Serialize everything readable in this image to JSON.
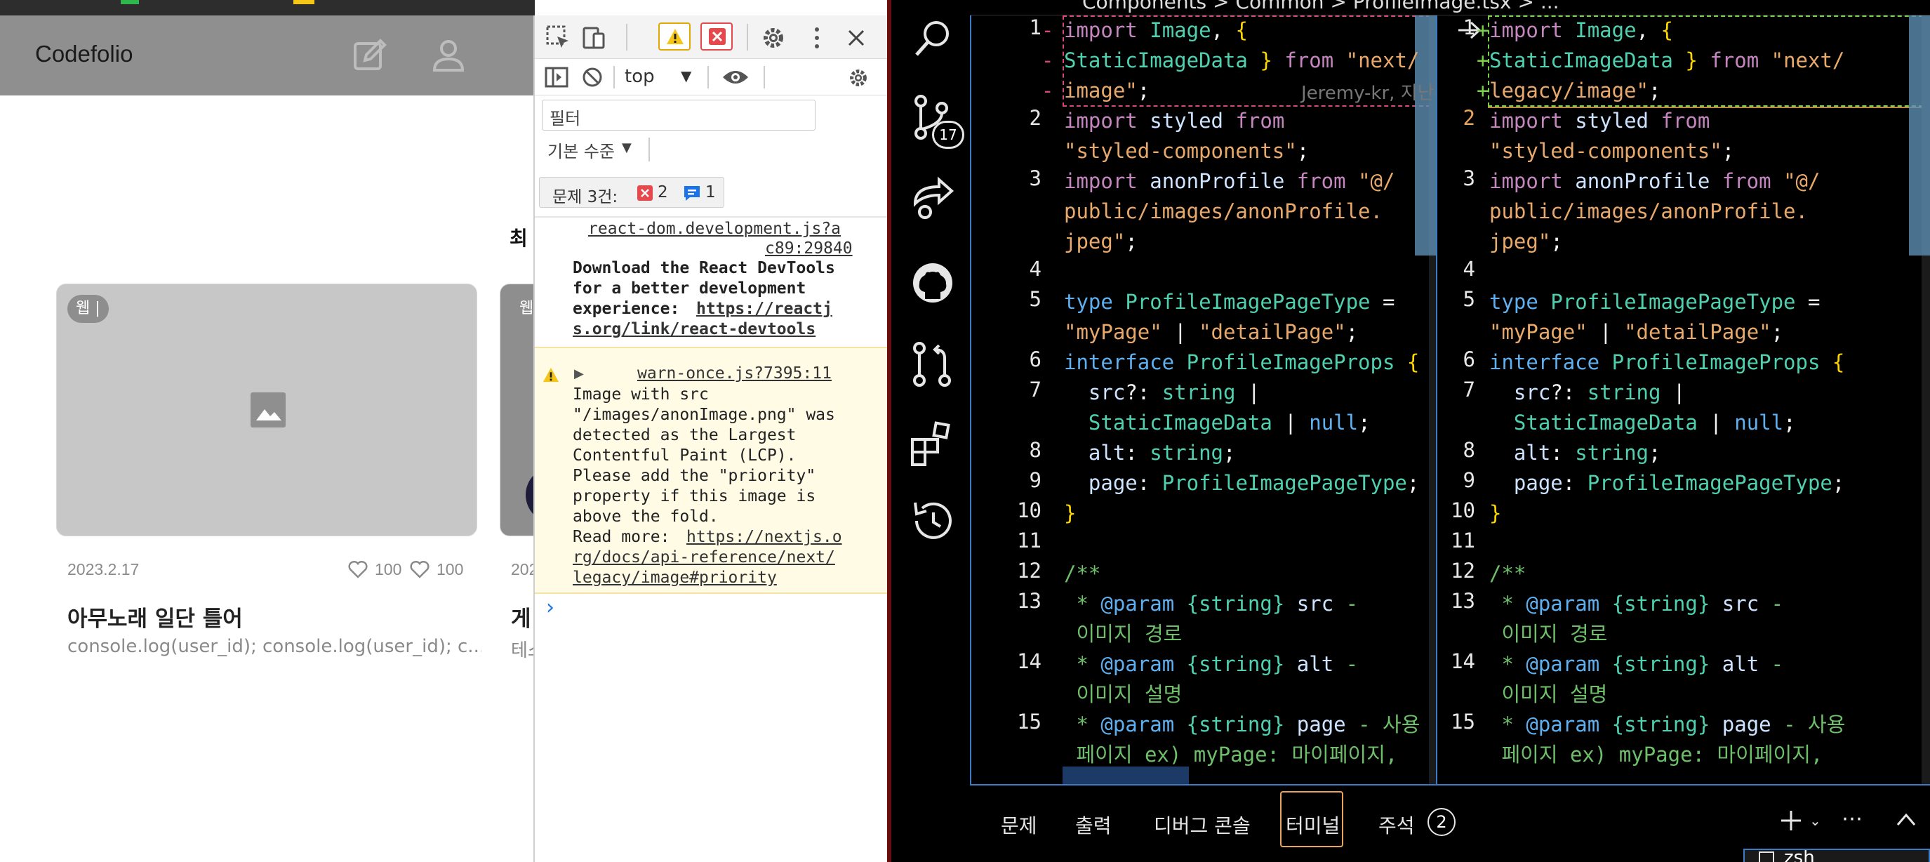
{
  "app": {
    "brand": "Codefolio"
  },
  "main": {
    "section_title": "최",
    "cards": [
      {
        "tag": "웹 |",
        "date": "2023.2.17",
        "like1": "100",
        "like2": "100",
        "title": "아무노래 일단 틀어",
        "desc": "console.log(user_id); console.log(user_id); c..."
      },
      {
        "tag": "웹",
        "date": "202",
        "title": "게",
        "desc": "테스"
      }
    ]
  },
  "devtools": {
    "context": "top",
    "filter_placeholder": "필터",
    "level": "기본 수준",
    "issues_label": "문제 3건:",
    "issues_errors": "2",
    "issues_info": "1",
    "log1": {
      "source": "react-dom.development.js?a",
      "source2": "c89:29840",
      "msg_line1": "Download the React DevTools",
      "msg_line2": "for a better development",
      "msg_line3_pre": "experience: ",
      "link1": "https://reactj",
      "link2": "s.org/link/react-devtools"
    },
    "log2": {
      "source": "warn-once.js?7395:11",
      "lines": [
        "Image with src",
        "\"/images/anonImage.png\" was",
        "detected as the Largest",
        "Contentful Paint (LCP).",
        "Please add the \"priority\"",
        "property if this image is",
        "above the fold."
      ],
      "readmore": "Read more: ",
      "link1": "https://nextjs.o",
      "link2": "rg/docs/api-reference/next/",
      "link3": "legacy/image#priority"
    },
    "prompt": "›"
  },
  "vscode": {
    "breadcrumb": "Components > Common > ProfileImage.tsx > ...",
    "scm_badge": "17",
    "blame": "Jeremy-kr, 지난주 • f",
    "panel_tabs": [
      "문제",
      "출력",
      "디버그 콘솔",
      "터미널",
      "주석"
    ],
    "panel_badge": "2",
    "terminal_label": "zsh"
  },
  "colors": {
    "accent_active": "#e8a35c",
    "error": "#e5484d",
    "warning": "#f5c518",
    "info": "#1a73e8",
    "keyword": "#5fb0f0",
    "string": "#e8a96a",
    "type": "#4fd1b0"
  }
}
